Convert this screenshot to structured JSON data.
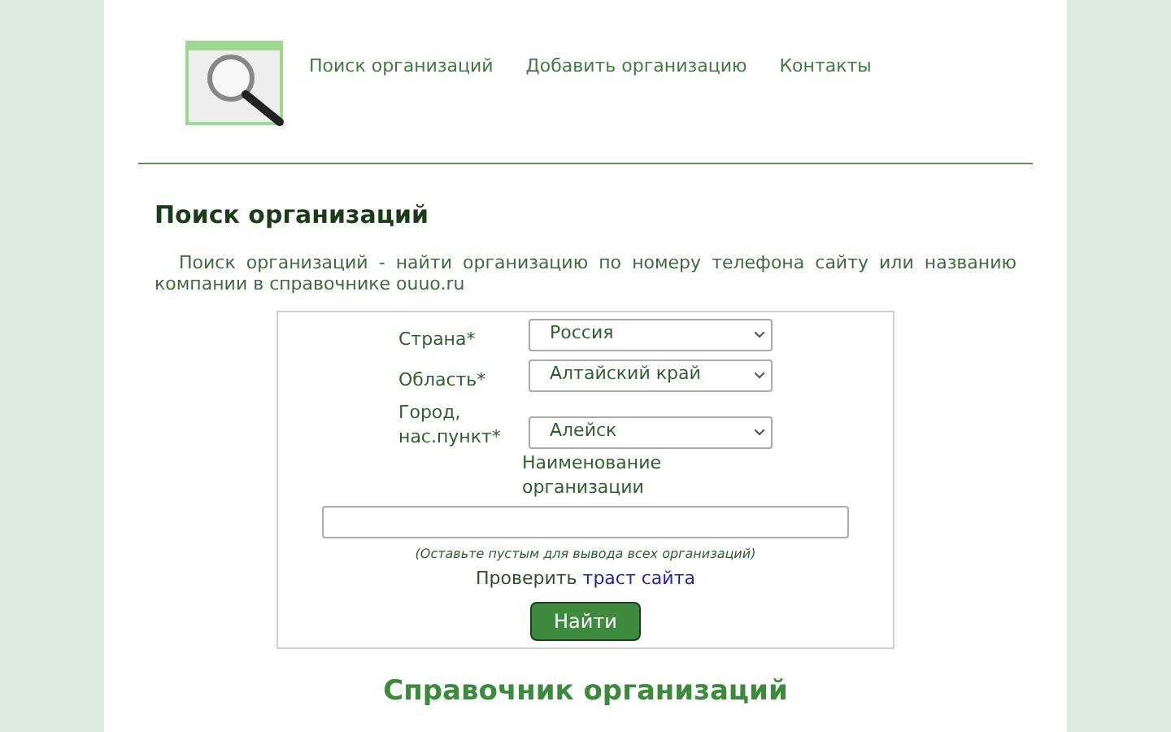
{
  "nav": [
    {
      "label": "Поиск организаций"
    },
    {
      "label": "Добавить организацию"
    },
    {
      "label": "Контакты"
    }
  ],
  "heading": "Поиск организаций",
  "intro": "Поиск организаций - найти организацию по номеру телефона сайту или названию компании в справочнике ouuo.ru",
  "form": {
    "selects": [
      {
        "label": "Страна*",
        "value": "Россия"
      },
      {
        "label": "Область*",
        "value": "Алтайский край"
      },
      {
        "label": "Город, нас.пункт*",
        "value": "Алейск"
      }
    ],
    "name_label": "Наименование организации",
    "hint": "(Оставьте пустым для вывода всех организаций)",
    "check_text": "Проверить",
    "check_link": "траст сайта",
    "submit": "Найти"
  },
  "directory_heading": "Справочник организаций"
}
